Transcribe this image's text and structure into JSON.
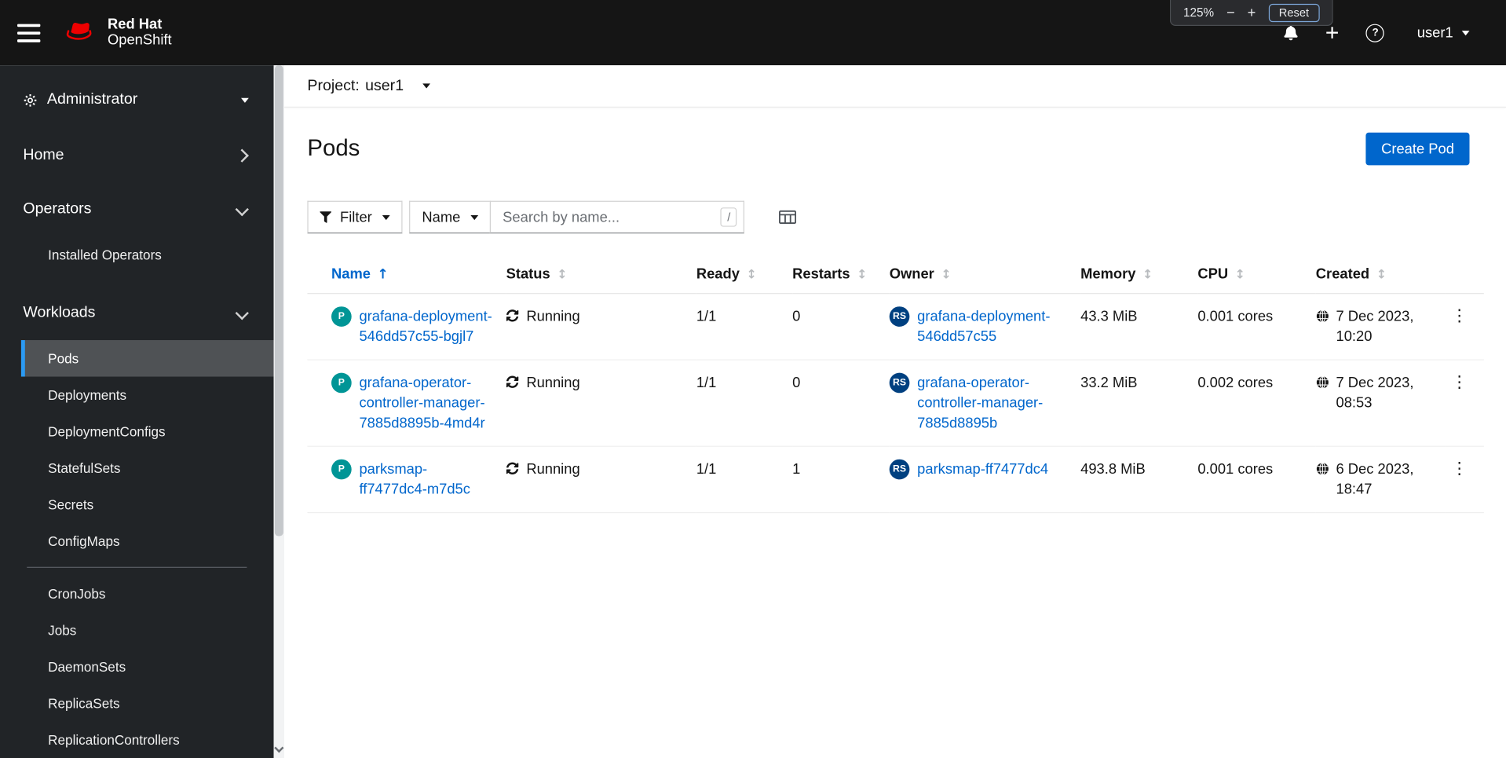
{
  "masthead": {
    "brand_line1": "Red Hat",
    "brand_line2": "OpenShift",
    "user_label": "user1",
    "zoom_popup": {
      "level": "125%",
      "minus": "−",
      "plus": "+",
      "reset_label": "Reset"
    }
  },
  "sidebar": {
    "perspective": "Administrator",
    "home_label": "Home",
    "operators_label": "Operators",
    "operators_items": [
      {
        "label": "Installed Operators",
        "active": false
      }
    ],
    "workloads_label": "Workloads",
    "workloads_items": [
      {
        "label": "Pods",
        "active": true
      },
      {
        "label": "Deployments"
      },
      {
        "label": "DeploymentConfigs"
      },
      {
        "label": "StatefulSets"
      },
      {
        "label": "Secrets"
      },
      {
        "label": "ConfigMaps",
        "divider_after": true
      },
      {
        "label": "CronJobs"
      },
      {
        "label": "Jobs"
      },
      {
        "label": "DaemonSets"
      },
      {
        "label": "ReplicaSets"
      },
      {
        "label": "ReplicationControllers"
      }
    ]
  },
  "project_bar": {
    "label": "Project:",
    "value": "user1"
  },
  "page": {
    "title": "Pods",
    "create_button_label": "Create Pod"
  },
  "toolbar": {
    "filter_label": "Filter",
    "attribute_label": "Name",
    "search_placeholder": "Search by name...",
    "search_shortcut": "/"
  },
  "table": {
    "columns": [
      {
        "label": "Name",
        "sorted": "asc"
      },
      {
        "label": "Status"
      },
      {
        "label": "Ready"
      },
      {
        "label": "Restarts"
      },
      {
        "label": "Owner"
      },
      {
        "label": "Memory"
      },
      {
        "label": "CPU"
      },
      {
        "label": "Created"
      }
    ],
    "rows": [
      {
        "badge": "P",
        "name": "grafana-deployment-546dd57c55-bgjl7",
        "status": "Running",
        "ready": "1/1",
        "restarts": "0",
        "owner_badge": "RS",
        "owner": "grafana-deployment-546dd57c55",
        "memory": "43.3 MiB",
        "cpu": "0.001 cores",
        "created": "7 Dec 2023, 10:20"
      },
      {
        "badge": "P",
        "name": "grafana-operator-controller-manager-7885d8895b-4md4r",
        "status": "Running",
        "ready": "1/1",
        "restarts": "0",
        "owner_badge": "RS",
        "owner": "grafana-operator-controller-manager-7885d8895b",
        "memory": "33.2 MiB",
        "cpu": "0.002 cores",
        "created": "7 Dec 2023, 08:53"
      },
      {
        "badge": "P",
        "name": "parksmap-ff7477dc4-m7d5c",
        "status": "Running",
        "ready": "1/1",
        "restarts": "1",
        "owner_badge": "RS",
        "owner": "parksmap-ff7477dc4",
        "memory": "493.8 MiB",
        "cpu": "0.001 cores",
        "created": "6 Dec 2023, 18:47"
      }
    ]
  },
  "icons": {
    "menu": "hamburger-bars",
    "brand": "red-hat-fedora",
    "masthead_right": [
      "notification-bell",
      "quick-create-plus",
      "help-question-circle"
    ],
    "perspective": "gear",
    "filter": "funnel",
    "columns_management": "table-columns",
    "status_running": "sync-arrows",
    "created": "globe",
    "row_actions": "kebab-vertical-dots",
    "sort_unsorted_glyph": "↕",
    "sort_ascending_glyph": "↑"
  },
  "colors": {
    "link": "#0066cc",
    "primary_button": "#0066cc",
    "pod_badge": "#009596",
    "replicaset_badge": "#004080",
    "masthead_bg": "#151515",
    "sidebar_bg": "#212427",
    "active_nav_bg": "#4f5255",
    "active_nav_indicator": "#2b9af3",
    "brand_red": "#ee0000"
  }
}
